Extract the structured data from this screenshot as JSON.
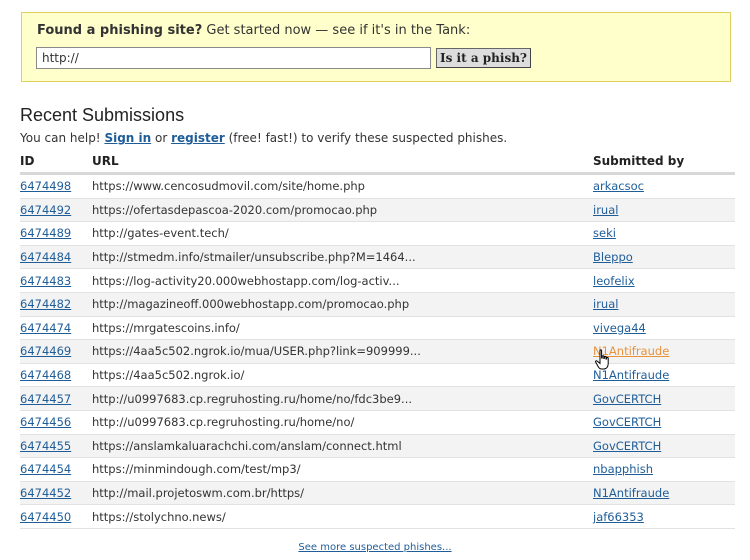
{
  "check": {
    "prompt_strong": "Found a phishing site?",
    "prompt_rest": " Get started now — see if it's in the Tank:",
    "input_value": "http://",
    "button_label": "Is it a phish?"
  },
  "recent": {
    "title": "Recent Submissions",
    "help_prefix": "You can help! ",
    "sign_in": "Sign in",
    "or": " or ",
    "register": "register",
    "help_suffix": " (free! fast!) to verify these suspected phishes.",
    "columns": [
      "ID",
      "URL",
      "Submitted by"
    ],
    "rows": [
      {
        "id": "6474498",
        "url": "https://www.cencosudmovil.com/site/home.php",
        "by": "arkacsoc"
      },
      {
        "id": "6474492",
        "url": "https://ofertasdepascoa-2020.com/promocao.php",
        "by": "irual"
      },
      {
        "id": "6474489",
        "url": "http://gates-event.tech/",
        "by": "seki"
      },
      {
        "id": "6474484",
        "url": "http://stmedm.info/stmailer/unsubscribe.php?M=1464...",
        "by": "Bleppo"
      },
      {
        "id": "6474483",
        "url": "https://log-activity20.000webhostapp.com/log-activ...",
        "by": "leofelix"
      },
      {
        "id": "6474482",
        "url": "http://magazineoff.000webhostapp.com/promocao.php",
        "by": "irual"
      },
      {
        "id": "6474474",
        "url": "https://mrgatescoins.info/",
        "by": "vivega44"
      },
      {
        "id": "6474469",
        "url": "https://4aa5c502.ngrok.io/mua/USER.php?link=909999...",
        "by": "N1Antifraude"
      },
      {
        "id": "6474468",
        "url": "https://4aa5c502.ngrok.io/",
        "by": "N1Antifraude"
      },
      {
        "id": "6474457",
        "url": "http://u0997683.cp.regruhosting.ru/home/no/fdc3be9...",
        "by": "GovCERTCH"
      },
      {
        "id": "6474456",
        "url": "http://u0997683.cp.regruhosting.ru/home/no/",
        "by": "GovCERTCH"
      },
      {
        "id": "6474455",
        "url": "https://anslamkaluarachchi.com/anslam/connect.html",
        "by": "GovCERTCH"
      },
      {
        "id": "6474454",
        "url": "https://minmindough.com/test/mp3/",
        "by": "nbapphish"
      },
      {
        "id": "6474452",
        "url": "http://mail.projetoswm.com.br/https/",
        "by": "N1Antifraude"
      },
      {
        "id": "6474450",
        "url": "https://stolychno.news/",
        "by": "jaf66353"
      }
    ],
    "more_link": "See more suspected phishes...",
    "hovered_row": 7
  },
  "colors": {
    "link": "#1f5d99",
    "link_hover": "#e8923a",
    "check_box_bg": "#ffffcc",
    "check_box_border": "#e0d060",
    "row_alt_bg": "#f3f3f3"
  },
  "icons": {
    "cursor": "hand-pointer-icon"
  }
}
